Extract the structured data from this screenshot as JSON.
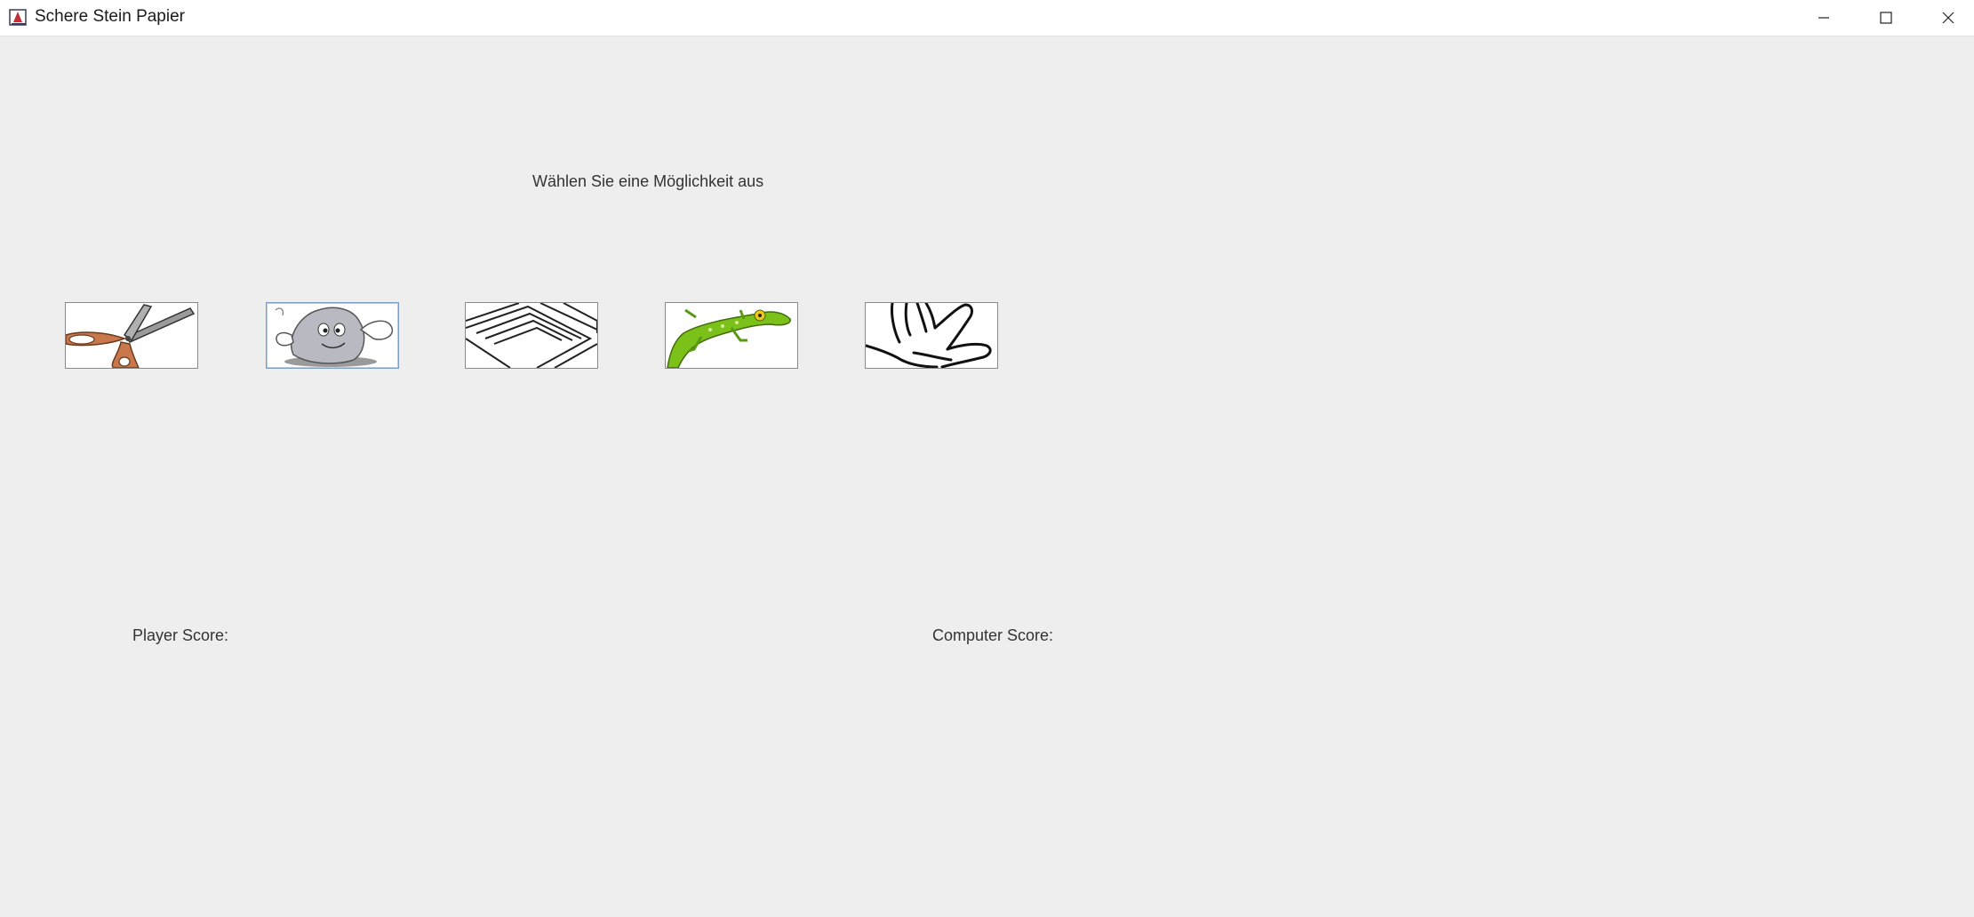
{
  "window": {
    "title": "Schere Stein Papier"
  },
  "main": {
    "prompt": "Wählen Sie eine Möglichkeit aus",
    "player_score_label": "Player Score:",
    "computer_score_label": "Computer Score:"
  },
  "choices": [
    {
      "icon": "scissors-icon"
    },
    {
      "icon": "rock-icon"
    },
    {
      "icon": "paper-icon"
    },
    {
      "icon": "lizard-icon"
    },
    {
      "icon": "spock-hand-icon"
    }
  ],
  "colors": {
    "background": "#eeeeee",
    "titlebar": "#ffffff",
    "lizard_green": "#7cc11a",
    "scissors_handle": "#c8784a"
  }
}
